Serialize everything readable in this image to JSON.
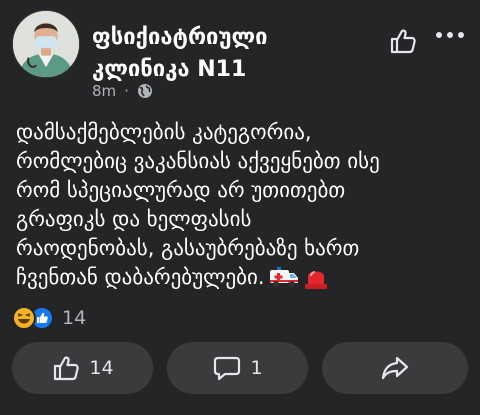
{
  "post": {
    "author": "ფსიქიატრიული კლინიკა N11",
    "time": "8m",
    "separator": "·",
    "privacy_icon": "globe-icon",
    "text": "დამსაქმებლების კატეგორია,\nრომლებიც ვაკანსიას აქვეყნებთ ისე\nრომ სპეციალურად არ უთითებთ\nგრაფიკს და ხელფასის\nრაოდენობას, გასაუბრებაზე ხართ\nჩვენთან დაბარებულები.",
    "emojis": [
      "ambulance-icon",
      "siren-icon"
    ]
  },
  "reactions": {
    "icons": [
      "haha-reaction-icon",
      "like-reaction-icon"
    ],
    "count": "14"
  },
  "actions": {
    "like_count": "14",
    "comment_count": "1",
    "share_icon": "share-icon"
  },
  "colors": {
    "background": "#242526",
    "button": "#3a3b3c",
    "like_blue": "#1877f2",
    "haha_yellow": "#f7b125",
    "secondary_text": "#b0b3b8"
  }
}
